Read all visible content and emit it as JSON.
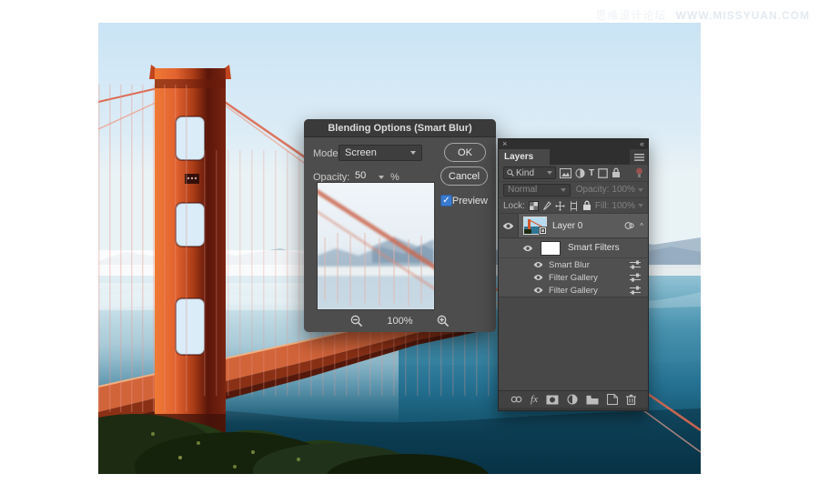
{
  "watermark": {
    "cn": "思缘设计论坛",
    "url": "WWW.MISSYUAN.COM"
  },
  "dialog": {
    "title": "Blending Options (Smart Blur)",
    "mode_label": "Mode:",
    "mode_value": "Screen",
    "opacity_label": "Opacity:",
    "opacity_value": "50",
    "opacity_unit": "%",
    "ok_label": "OK",
    "cancel_label": "Cancel",
    "preview_label": "Preview",
    "zoom_value": "100%"
  },
  "layers_panel": {
    "tab_label": "Layers",
    "kind_filter": "Kind",
    "blend_mode": "Normal",
    "opacity_label": "Opacity:",
    "opacity_value": "100%",
    "lock_label": "Lock:",
    "fill_label": "Fill:",
    "fill_value": "100%",
    "layer_name": "Layer 0",
    "smart_filters_label": "Smart Filters",
    "filters": [
      {
        "label": "Smart Blur"
      },
      {
        "label": "Filter Gallery"
      },
      {
        "label": "Filter Gallery"
      }
    ]
  },
  "icons": {
    "close_glyph": "×",
    "collapse_glyph": "«",
    "check_glyph": "✓",
    "fx_glyph": "fx",
    "type_glyph": "T",
    "caret_up": "^"
  },
  "colors": {
    "checkbox_blue": "#3a7bd0",
    "opacity_underline_blue": "#6fa0d8",
    "filter_toggle_red": "#9b5250",
    "bridge_orange": "#d4572c",
    "water_teal": "#1f6c8b"
  }
}
